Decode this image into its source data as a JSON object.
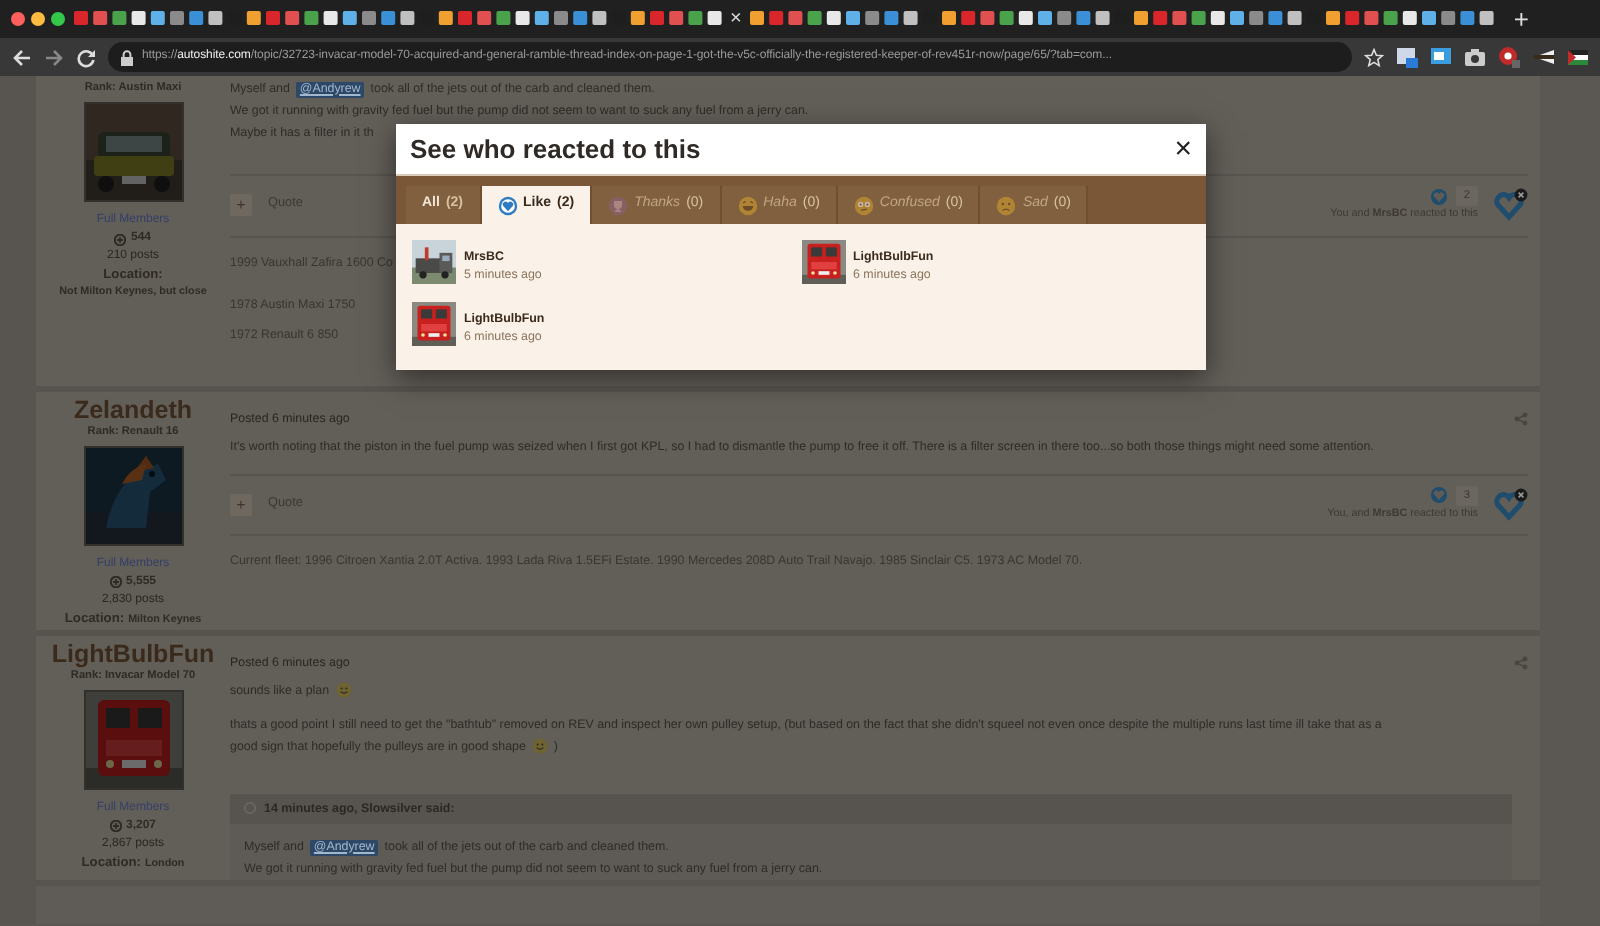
{
  "browser": {
    "tab_close": "×",
    "new_tab": "+",
    "url_scheme": "https://",
    "url_host": "autoshite.com",
    "url_path": "/topic/32723-invacar-model-70-acquired-and-general-ramble-thread-index-on-page-1-got-the-v5c-officially-the-registered-keeper-of-rev451r-now/page/65/?tab=com..."
  },
  "posts": [
    {
      "rank": "Rank: Austin Maxi",
      "group": "Full Members",
      "reputation": "544",
      "post_count": "210 posts",
      "location_label": "Location:",
      "location": "Not Milton Keynes, but close",
      "body": [
        [
          {
            "kind": "text",
            "text": "Myself and"
          },
          {
            "kind": "mention",
            "text": "@Andyrew"
          },
          {
            "kind": "text",
            "text": "took all of the jets out of the carb and cleaned them."
          }
        ],
        [
          {
            "kind": "text",
            "text": "We got it running with gravity fed fuel but the pump did not seem to want to suck any fuel from a jerry can."
          }
        ],
        [
          {
            "kind": "text",
            "text": "Maybe it has a filter in it th"
          }
        ]
      ],
      "quote_button": "+",
      "quote_label": "Quote",
      "reaction_count": "2",
      "reaction_summary": "You and **MrsBC** reacted to this",
      "signature": [
        "1999 Vauxhall Zafira 1600 Co",
        "1978 Austin Maxi 1750",
        "1972 Renault 6 850"
      ]
    },
    {
      "author": "Zelandeth",
      "rank": "Rank: Renault 16",
      "group": "Full Members",
      "reputation": "5,555",
      "post_count": "2,830 posts",
      "location_label": "Location:",
      "location": "Milton Keynes",
      "posted": "Posted 6 minutes ago",
      "body": [
        [
          {
            "kind": "text",
            "text": "It's worth noting that the piston in the fuel pump was seized when I first got KPL, so I had to dismantle the pump to free it off.  There is a filter screen in there too...so both those things might need some attention."
          }
        ]
      ],
      "quote_button": "+",
      "quote_label": "Quote",
      "reaction_count": "3",
      "reaction_summary": "You, and **MrsBC** reacted to this",
      "signature": [
        "Current fleet: 1996 Citroen Xantia 2.0T Activa. 1993 Lada Riva 1.5EFi Estate.  1990 Mercedes 208D Auto Trail Navajo.  1985 Sinclair C5.  1973 AC Model 70."
      ]
    },
    {
      "author": "LightBulbFun",
      "rank": "Rank: Invacar Model 70",
      "group": "Full Members",
      "reputation": "3,207",
      "post_count": "2,867 posts",
      "location_label": "Location:",
      "location": "London",
      "posted": "Posted 6 minutes ago",
      "body": [
        [
          {
            "kind": "text",
            "text": "sounds like a plan"
          },
          {
            "kind": "smiley"
          }
        ],
        [
          {
            "kind": "text",
            "text": "thats a good point I still need to get the \"bathtub\" removed on REV and inspect her own pulley setup, (but based on the fact that she didn't squeel not even once despite the multiple runs last time ill take that as a"
          }
        ],
        [
          {
            "kind": "text",
            "text": "good sign that hopefully the pulleys are in good shape"
          },
          {
            "kind": "smiley"
          },
          {
            "kind": "text",
            "text": ")"
          }
        ]
      ],
      "quote": {
        "header": "14 minutes ago, Slowsilver said:",
        "lines": [
          [
            {
              "kind": "text",
              "text": "Myself and"
            },
            {
              "kind": "mention",
              "text": "@Andyrew"
            },
            {
              "kind": "text",
              "text": "took all of the jets out of the carb and cleaned them."
            }
          ],
          [
            {
              "kind": "text",
              "text": "We got it running with gravity fed fuel but the pump did not seem to want to suck any fuel from a jerry can."
            }
          ]
        ]
      }
    }
  ],
  "modal": {
    "title": "See who reacted to this",
    "close": "×",
    "tabs": [
      {
        "kind": "all",
        "label": "All",
        "count": "(2)",
        "selected": false
      },
      {
        "kind": "like",
        "label": "Like",
        "count": "(2)",
        "selected": true
      },
      {
        "kind": "thanks",
        "label": "Thanks",
        "count": "(0)",
        "selected": false
      },
      {
        "kind": "haha",
        "label": "Haha",
        "count": "(0)",
        "selected": false
      },
      {
        "kind": "confused",
        "label": "Confused",
        "count": "(0)",
        "selected": false
      },
      {
        "kind": "sad",
        "label": "Sad",
        "count": "(0)",
        "selected": false
      }
    ],
    "reactors": [
      {
        "name": "MrsBC",
        "time": "5 minutes ago"
      },
      {
        "name": "LightBulbFun",
        "time": "6 minutes ago"
      },
      {
        "name": "LightBulbFun",
        "time": "6 minutes ago"
      }
    ]
  }
}
